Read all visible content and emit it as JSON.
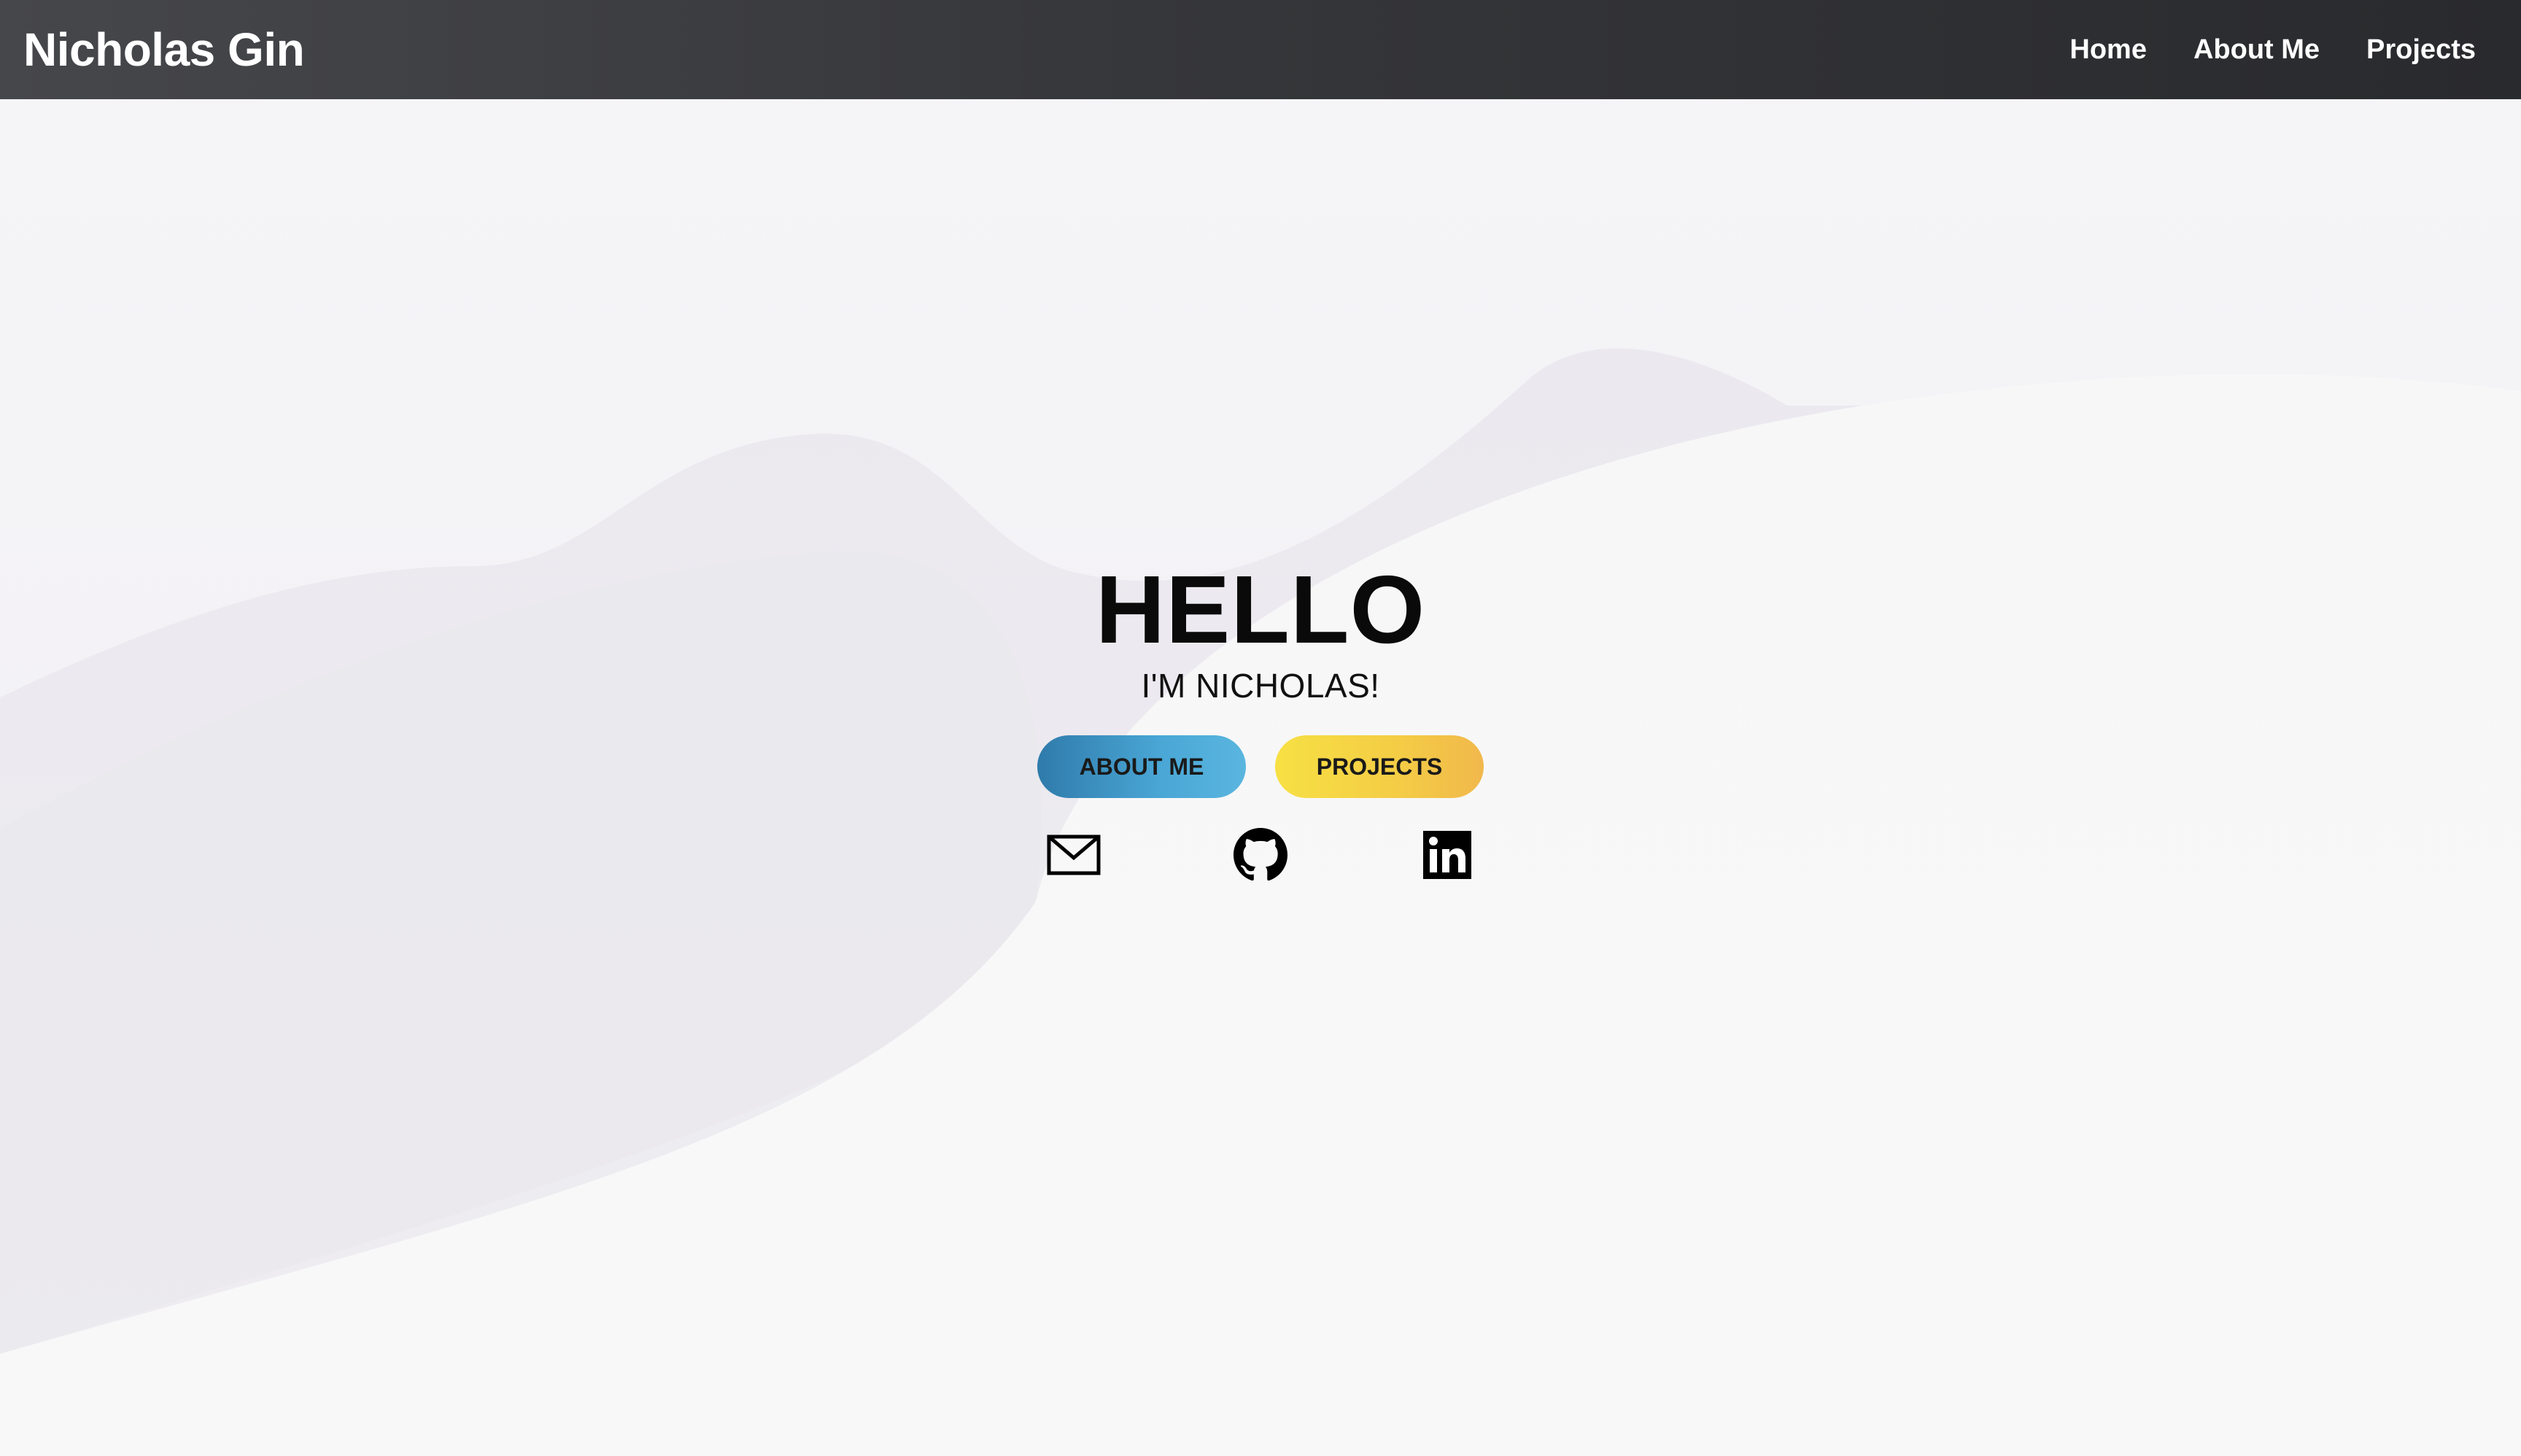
{
  "navbar": {
    "brand": "Nicholas Gin",
    "links": [
      {
        "label": "Home"
      },
      {
        "label": "About Me"
      },
      {
        "label": "Projects"
      }
    ]
  },
  "hero": {
    "title": "HELLO",
    "subtitle": "I'M NICHOLAS!",
    "buttons": {
      "about_label": "ABOUT ME",
      "projects_label": "PROJECTS"
    },
    "social_icons": [
      "mail-icon",
      "github-icon",
      "linkedin-icon"
    ]
  },
  "colors": {
    "navbar_dark": "#2b2c2f",
    "about_button": "#3f95c6",
    "projects_button": "#f5d545",
    "background": "#f6f6f8"
  }
}
